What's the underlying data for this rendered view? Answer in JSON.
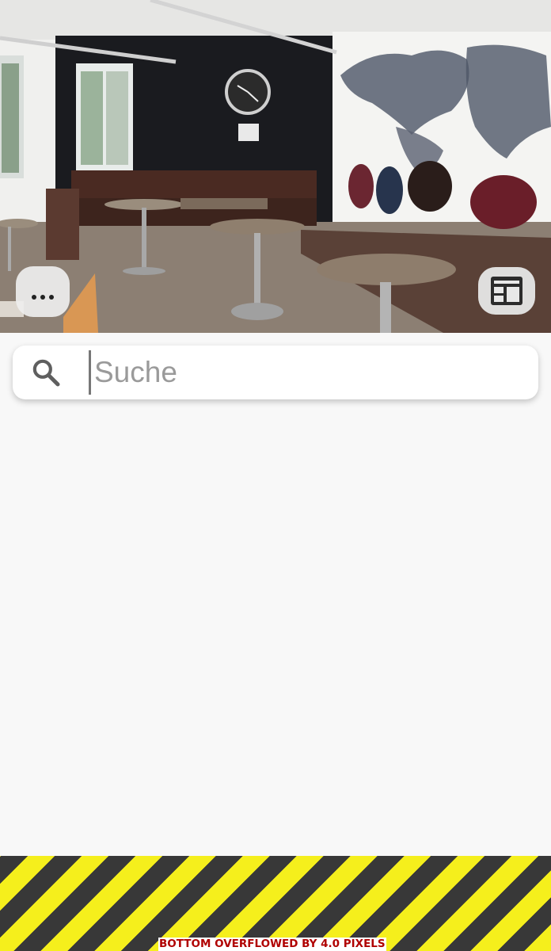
{
  "header": {
    "image_description_icon": "room-photo",
    "more_button_icon": "more-horizontal-icon",
    "feed_button_icon": "feed-icon"
  },
  "search": {
    "placeholder": "Suche",
    "value": "",
    "icon": "search-icon"
  },
  "debug": {
    "overflow_message": "BOTTOM OVERFLOWED BY 4.0 PIXELS"
  },
  "colors": {
    "background": "#f8f8f8",
    "search_background": "#ffffff",
    "stripe_yellow": "#f5ef1c",
    "stripe_dark": "#383838",
    "overflow_text": "#b00000"
  }
}
